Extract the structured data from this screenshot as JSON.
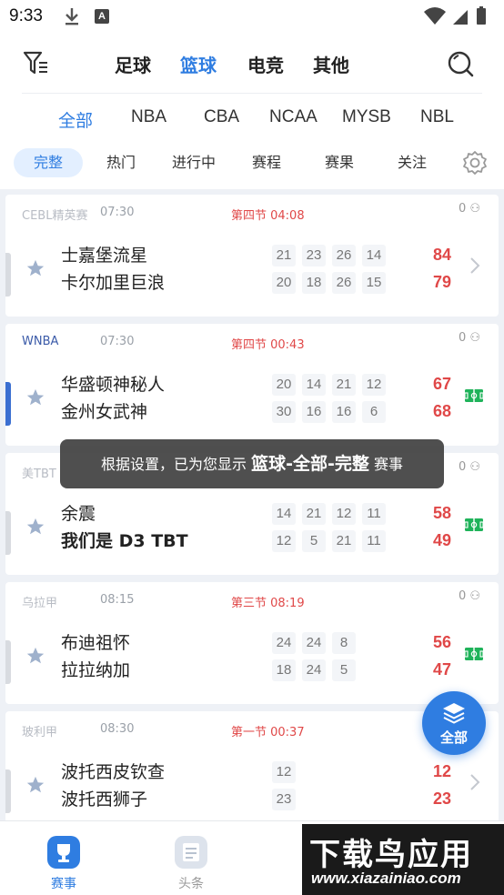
{
  "status_bar": {
    "time": "9:33",
    "notif_icon_letter": "A"
  },
  "sport_tabs": [
    {
      "label": "足球",
      "active": false
    },
    {
      "label": "篮球",
      "active": true
    },
    {
      "label": "电竞",
      "active": false
    },
    {
      "label": "其他",
      "active": false
    }
  ],
  "league_tabs": [
    {
      "label": "全部",
      "active": true
    },
    {
      "label": "NBA",
      "active": false
    },
    {
      "label": "CBA",
      "active": false
    },
    {
      "label": "NCAA",
      "active": false
    },
    {
      "label": "MYSB",
      "active": false
    },
    {
      "label": "NBL",
      "active": false
    }
  ],
  "status_tabs": [
    {
      "label": "完整",
      "active": true
    },
    {
      "label": "热门",
      "active": false
    },
    {
      "label": "进行中",
      "active": false
    },
    {
      "label": "赛程",
      "active": false
    },
    {
      "label": "赛果",
      "active": false
    },
    {
      "label": "关注",
      "active": false
    }
  ],
  "matches": [
    {
      "league": "CEBL精英赛",
      "time": "07:30",
      "period": "第四节 04:08",
      "fans": "0",
      "home": {
        "name": "士嘉堡流星",
        "quarters": [
          "21",
          "23",
          "26",
          "14"
        ],
        "total": "84"
      },
      "away": {
        "name": "卡尔加里巨浪",
        "quarters": [
          "20",
          "18",
          "26",
          "15"
        ],
        "total": "79"
      },
      "action": "chevron",
      "live_bar": false
    },
    {
      "league": "WNBA",
      "time": "07:30",
      "period": "第四节 00:43",
      "fans": "0",
      "home": {
        "name": "华盛顿神秘人",
        "quarters": [
          "20",
          "14",
          "21",
          "12"
        ],
        "total": "67"
      },
      "away": {
        "name": "金州女武神",
        "quarters": [
          "30",
          "16",
          "16",
          "6"
        ],
        "total": "68"
      },
      "action": "court",
      "live_bar": true
    },
    {
      "league": "美TBT",
      "time": "",
      "period": "",
      "fans": "0",
      "home": {
        "name": "余震",
        "quarters": [
          "14",
          "21",
          "12",
          "11"
        ],
        "total": "58"
      },
      "away": {
        "name": "我们是 D3 TBT",
        "quarters": [
          "12",
          "5",
          "21",
          "11"
        ],
        "total": "49"
      },
      "action": "court",
      "live_bar": false
    },
    {
      "league": "乌拉甲",
      "time": "08:15",
      "period": "第三节 08:19",
      "fans": "0",
      "home": {
        "name": "布迪祖怀",
        "quarters": [
          "24",
          "24",
          "8"
        ],
        "total": "56"
      },
      "away": {
        "name": "拉拉纳加",
        "quarters": [
          "18",
          "24",
          "5"
        ],
        "total": "47"
      },
      "action": "court",
      "live_bar": false
    },
    {
      "league": "玻利甲",
      "time": "08:30",
      "period": "第一节 00:37",
      "fans": "",
      "home": {
        "name": "波托西皮钦查",
        "quarters": [
          "12"
        ],
        "total": "12"
      },
      "away": {
        "name": "波托西狮子",
        "quarters": [
          "23"
        ],
        "total": "23"
      },
      "action": "chevron",
      "live_bar": false
    }
  ],
  "toast": {
    "prefix": "根据设置，已为您显示",
    "highlight": "篮球-全部-完整",
    "suffix": "赛事"
  },
  "fab": {
    "label": "全部"
  },
  "bottom_nav": [
    {
      "label": "赛事",
      "active": true
    },
    {
      "label": "头条",
      "active": false
    }
  ],
  "watermark": {
    "title": "下载鸟应用",
    "url": "www.xiazainiao.com"
  },
  "colors": {
    "accent": "#2f7de1",
    "score_red": "#e04848",
    "live_green": "#1fb35a"
  }
}
